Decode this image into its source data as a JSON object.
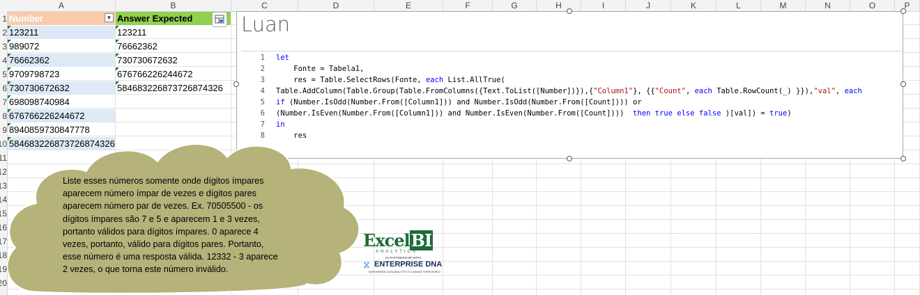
{
  "columns": [
    "A",
    "B",
    "C",
    "D",
    "E",
    "F",
    "G",
    "H",
    "I",
    "J",
    "K",
    "L",
    "M",
    "N",
    "O",
    "P"
  ],
  "rows": [
    "1",
    "2",
    "3",
    "4",
    "5",
    "6",
    "7",
    "8",
    "9",
    "10",
    "11",
    "12",
    "13",
    "14",
    "15",
    "16",
    "17",
    "18",
    "19",
    "20"
  ],
  "table": {
    "header_number": "Number",
    "header_expected": "Answer Expected",
    "numbers": [
      "123211",
      "989072",
      "76662362",
      "9709798723",
      "730730672632",
      "698098740984",
      "676766226244672",
      "8940859730847778",
      "584683226873726874326"
    ],
    "expected": [
      "123211",
      "76662362",
      "730730672632",
      "676766226244672",
      "584683226873726874326"
    ]
  },
  "pane": {
    "title": "Luan",
    "code": [
      {
        "n": "1",
        "segs": [
          {
            "t": "let",
            "c": "kw"
          }
        ]
      },
      {
        "n": "2",
        "segs": [
          {
            "t": "    Fonte = Tabela1,",
            "c": ""
          }
        ]
      },
      {
        "n": "3",
        "segs": [
          {
            "t": "    res = Table.SelectRows(Fonte, ",
            "c": ""
          },
          {
            "t": "each",
            "c": "kw"
          },
          {
            "t": " List.AllTrue(",
            "c": ""
          }
        ]
      },
      {
        "n": "4",
        "segs": [
          {
            "t": "Table.AddColumn(Table.Group(Table.FromColumns({Text.ToList([Number])}),{",
            "c": ""
          },
          {
            "t": "\"Column1\"",
            "c": "st"
          },
          {
            "t": "}, {{",
            "c": ""
          },
          {
            "t": "\"Count\"",
            "c": "st"
          },
          {
            "t": ", ",
            "c": ""
          },
          {
            "t": "each",
            "c": "kw"
          },
          {
            "t": " Table.RowCount(_) }}),",
            "c": ""
          },
          {
            "t": "\"val\"",
            "c": "st"
          },
          {
            "t": ", ",
            "c": ""
          },
          {
            "t": "each",
            "c": "kw"
          }
        ]
      },
      {
        "n": "5",
        "segs": [
          {
            "t": "if",
            "c": "kw"
          },
          {
            "t": " (Number.IsOdd(Number.From([Column1])) and Number.IsOdd(Number.From([Count]))) or",
            "c": ""
          }
        ]
      },
      {
        "n": "6",
        "segs": [
          {
            "t": "(Number.IsEven(Number.From([Column1])) and Number.IsEven(Number.From([Count])))  ",
            "c": ""
          },
          {
            "t": "then true else false",
            "c": "kw"
          },
          {
            "t": " )[val]) = ",
            "c": ""
          },
          {
            "t": "true",
            "c": "kw"
          },
          {
            "t": ")",
            "c": ""
          }
        ]
      },
      {
        "n": "7",
        "segs": [
          {
            "t": "in",
            "c": "kw"
          }
        ]
      },
      {
        "n": "8",
        "segs": [
          {
            "t": "    res",
            "c": ""
          }
        ]
      }
    ]
  },
  "callout": "Liste esses números somente onde dígitos ímpares aparecem número ímpar de vezes e dígitos pares aparecem número par de vezes. Ex. 70505500 - os dígitos ímpares são 7 e 5 e aparecem 1 e 3 vezes, portanto válidos para dígitos ímpares. 0 aparece 4 vezes, portanto, válido para dígitos pares. Portanto, esse número é uma resposta válida. 12332 - 3 aparece 2 vezes, o que torna este número inválido.",
  "logo": {
    "brand_excel": "Excel",
    "brand_bi": "BI",
    "analytics": "ANALYTICS",
    "partnership": "IN PARTNERSHIP WITH",
    "partner": "ENTERPRISE DNA",
    "tagline": "EMPOWERING DATA ANALYSTS TO CHANGE THEIR WORLD"
  },
  "colors": {
    "header_number_bg": "#f8cbad",
    "header_expected_bg": "#92d050",
    "band": "#dde9f6",
    "cloud_fill": "#b5b27a",
    "keyword": "#0000ff",
    "string": "#a31515"
  }
}
